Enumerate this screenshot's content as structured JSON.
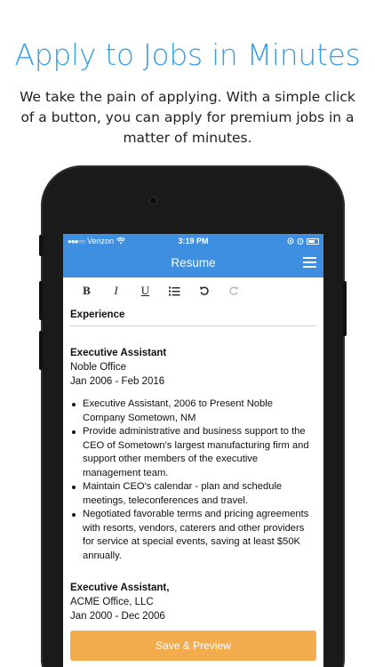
{
  "hero": {
    "headline": "Apply to Jobs in Minutes",
    "subtext": "We take the pain of applying. With a simple click of a button, you can apply for premium jobs in a matter of minutes."
  },
  "status_bar": {
    "carrier": "Verizon",
    "time": "3:19 PM"
  },
  "nav": {
    "title": "Resume"
  },
  "toolbar": {
    "bold": "B",
    "italic": "I",
    "underline": "U",
    "list": "≔",
    "undo": "↶",
    "redo": "↷"
  },
  "section": {
    "title": "Experience"
  },
  "jobs": [
    {
      "title": "Executive Assistant",
      "company": "Noble Office",
      "dates": "Jan 2006 - Feb 2016",
      "bullets": [
        "Executive Assistant, 2006 to Present Noble Company Sometown, NM",
        "Provide administrative and business support to the CEO of Sometown's largest manufacturing firm and support other members of the executive management team.",
        "Maintain CEO's calendar - plan and schedule meetings, teleconferences and travel.",
        "Negotiated favorable terms and pricing agreements with resorts, vendors, caterers and other providers for service at special events, saving at least $50K annually."
      ]
    },
    {
      "title": "Executive Assistant,",
      "company": "ACME Office, LLC",
      "dates": "Jan 2000 - Dec 2006"
    }
  ],
  "actions": {
    "save_preview": "Save & Preview"
  },
  "colors": {
    "headline": "#3a9ee0",
    "nav_bar": "#3f8fe0",
    "save_button": "#f2ac4e"
  }
}
